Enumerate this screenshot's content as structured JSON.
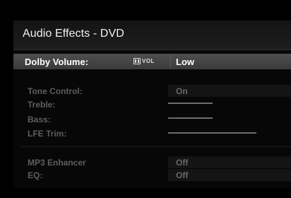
{
  "screen": {
    "title": "Audio Effects - DVD"
  },
  "selected": {
    "label": "Dolby Volume:",
    "logo_text": "VOL",
    "value": "Low"
  },
  "settings": [
    {
      "label": "Tone Control:",
      "value": "On"
    },
    {
      "label": "Treble:",
      "level": 0.5
    },
    {
      "label": "Bass:",
      "level": 0.5
    },
    {
      "label": "LFE Trim:",
      "level": 1.0
    }
  ],
  "extras": [
    {
      "label": "MP3 Enhancer",
      "value": "Off"
    },
    {
      "label": "EQ:",
      "value": "Off"
    }
  ]
}
